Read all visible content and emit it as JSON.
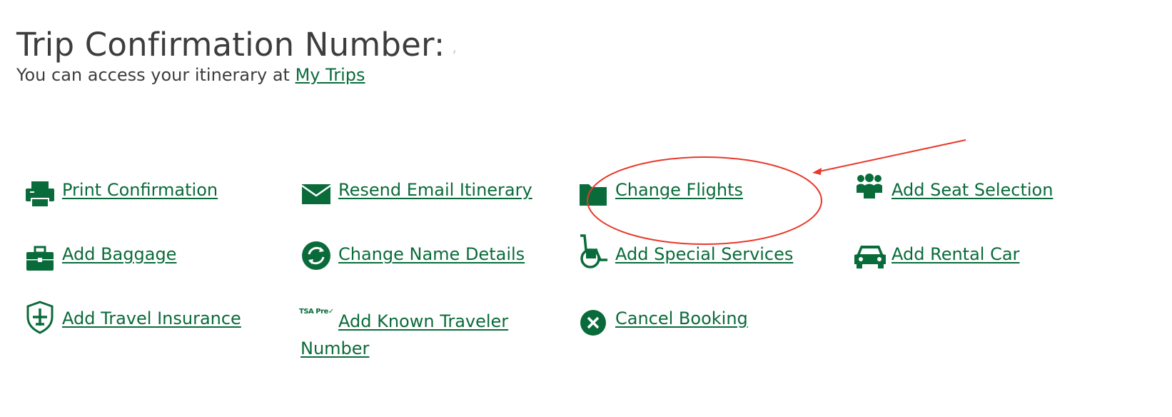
{
  "header": {
    "title": "Trip Confirmation Number:",
    "redacted_mark": "‚",
    "subtitle_prefix": "You can access your itinerary at ",
    "my_trips_link": "My Trips"
  },
  "actions": {
    "print_confirmation": "Print Confirmation",
    "resend_email": "Resend Email Itinerary",
    "change_flights": "Change Flights",
    "add_seat_selection": "Add Seat Selection",
    "add_baggage": "Add Baggage",
    "change_name_details": "Change Name Details",
    "add_special_services": "Add Special Services",
    "add_rental_car": "Add Rental Car",
    "add_travel_insurance": "Add Travel Insurance",
    "tsa_badge": "TSA Pre✓",
    "add_known_traveler": "Add Known Traveler Number",
    "cancel_booking": "Cancel Booking"
  },
  "icons": {
    "print_confirmation": "printer-icon",
    "resend_email": "envelope-icon",
    "change_flights": "folder-icon",
    "add_seat_selection": "people-icon",
    "add_baggage": "briefcase-icon",
    "change_name_details": "refresh-icon",
    "add_special_services": "wheelchair-icon",
    "add_rental_car": "car-icon",
    "add_travel_insurance": "shield-plane-icon",
    "add_known_traveler": "tsa-precheck-icon",
    "cancel_booking": "cancel-x-icon"
  },
  "colors": {
    "link_green": "#0a6b3a",
    "text_gray": "#3d3d3d",
    "annotation_red": "#e8382a"
  }
}
